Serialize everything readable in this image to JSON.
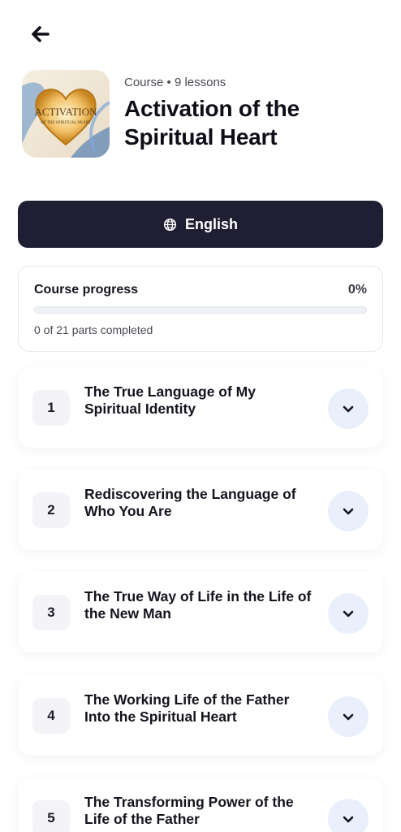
{
  "header": {
    "meta": "Course • 9 lessons",
    "title": "Activation of the Spiritual Heart",
    "art_text_main": "ACTIVATION",
    "art_text_sub": "OF THE SPIRITUAL HEART"
  },
  "language": {
    "label": "English"
  },
  "progress": {
    "label": "Course progress",
    "percent_text": "0%",
    "percent_value": 0,
    "completed_text": "0 of 21 parts completed"
  },
  "lessons": [
    {
      "number": "1",
      "title": "The True Language of My Spiritual Identity"
    },
    {
      "number": "2",
      "title": "Rediscovering the Language of Who You Are"
    },
    {
      "number": "3",
      "title": "The True Way of Life in the Life of the New Man"
    },
    {
      "number": "4",
      "title": "The Working Life of the Father Into the Spiritual Heart"
    },
    {
      "number": "5",
      "title": "The Transforming Power of the Life of the Father"
    }
  ],
  "colors": {
    "primary_dark": "#1f1e33",
    "expand_bg": "#e9f0fb",
    "number_bg": "#f4f4f8"
  },
  "icons": {
    "back": "arrow-left-icon",
    "language": "globe-icon",
    "expand": "chevron-down-icon"
  }
}
